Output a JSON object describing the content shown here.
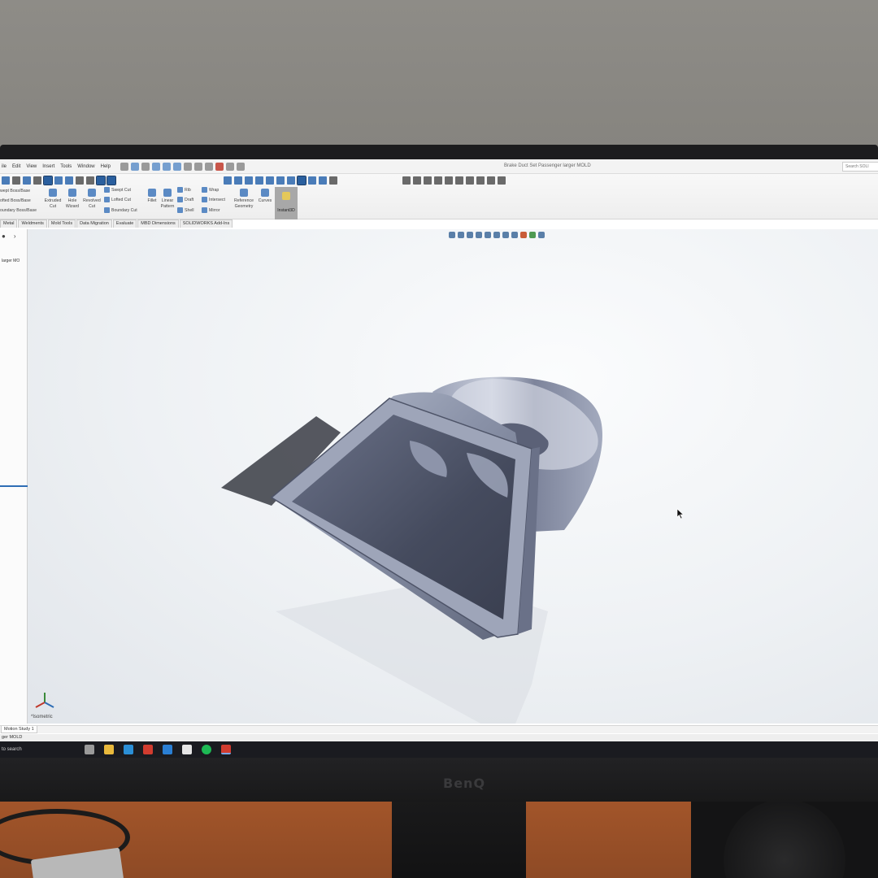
{
  "app": {
    "document_title": "Brake Duct Set Passenger larger MOLD",
    "search_placeholder": "Search SOLI"
  },
  "menu": [
    "ile",
    "Edit",
    "View",
    "Insert",
    "Tools",
    "Window",
    "Help"
  ],
  "features": {
    "swept_boss": "wept Boss/Base",
    "lofted_boss": "ofted Boss/Base",
    "boundary_boss": "oundary Boss/Base",
    "extruded_cut": "Extruded\nCut",
    "hole_wizard": "Hole\nWizard",
    "revolved_cut": "Revolved\nCut",
    "swept_cut": "Swept Cut",
    "lofted_cut": "Lofted Cut",
    "boundary_cut": "Boundary Cut",
    "fillet": "Fillet",
    "linear_pattern": "Linear\nPattern",
    "rib": "Rib",
    "draft": "Draft",
    "shell": "Shell",
    "wrap": "Wrap",
    "intersect": "Intersect",
    "mirror": "Mirror",
    "reference_geometry": "Reference\nGeometry",
    "curves": "Curves",
    "instant3d": "Instant3D"
  },
  "tabs": [
    "Metal",
    "Weldments",
    "Mold Tools",
    "Data Migration",
    "Evaluate",
    "MBD Dimensions",
    "SOLIDWORKS Add-Ins"
  ],
  "tree": {
    "root_item": "larger MO"
  },
  "viewport": {
    "view_name": "*Isometric"
  },
  "bottom": {
    "motion_tab": "Motion Study 1",
    "status_text": "ger MOLD"
  },
  "taskbar": {
    "search_text": "to search"
  },
  "monitor": {
    "brand": "BenQ"
  },
  "colors": {
    "accent": "#2e6db5",
    "model": "#7e869b",
    "taskbar": "#1a1b20"
  }
}
